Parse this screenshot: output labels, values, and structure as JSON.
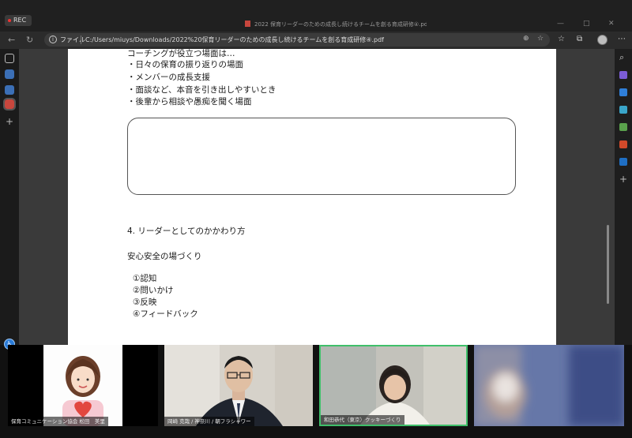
{
  "recorder": {
    "label": "REC"
  },
  "window": {
    "title": "2022 保育リーダーのための成長し続けるチームを創る育成研修④.pdf"
  },
  "addressbar": {
    "scheme_label": "ファイル",
    "url": "C:/Users/miuys/Downloads/2022%20保育リーダーのための成長し続けるチームを創る育成研修④.pdf"
  },
  "document": {
    "lines_top": [
      "コーチングが役立つ場面は…",
      "・日々の保育の振り返りの場面",
      "・メンバーの成長支援",
      "・面談など、本音を引き出しやすいとき",
      "・後輩から相談や愚痴を聞く場面"
    ],
    "section_heading": "4. リーダーとしてのかかわり方",
    "subheading": "安心安全の場づくり",
    "steps": [
      "①認知",
      "②問いかけ",
      "③反映",
      "④フィードバック"
    ]
  },
  "participants": [
    {
      "name": "保育コミュニケーション協会 松田　美里"
    },
    {
      "name": "岡崎 克哉 / 神奈川 / 朝フラシャワー"
    },
    {
      "name": "和田恭代（東京）クッキーづくり"
    },
    {
      "name": ""
    }
  ],
  "colors": {
    "accent_speaker": "#3fbf6a",
    "chrome_dark": "#202020",
    "page_bg": "#ffffff"
  }
}
